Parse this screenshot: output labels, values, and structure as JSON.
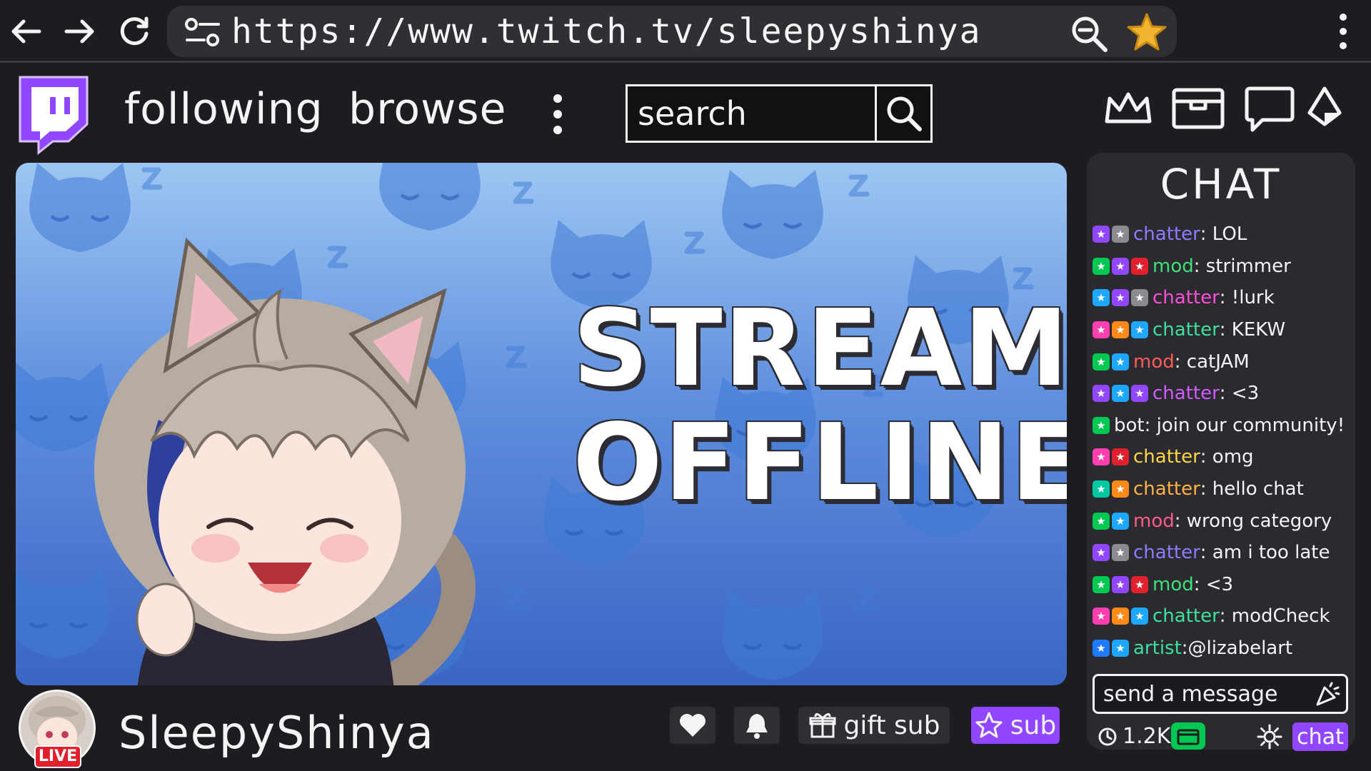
{
  "browser": {
    "url": "https://www.twitch.tv/sleepyshinya"
  },
  "header": {
    "following_label": "following",
    "browse_label": "browse",
    "search_placeholder": "search"
  },
  "banner": {
    "line1": "STREAM",
    "line2": "OFFLINE"
  },
  "channel": {
    "name": "SleepyShinya",
    "live_label": "LIVE",
    "gift_sub_label": "gift sub",
    "sub_label": "sub"
  },
  "chat": {
    "title": "CHAT",
    "messages": [
      {
        "badges": [
          "#9147ff",
          "#8a8a90"
        ],
        "role": "chatter",
        "name_color": "#8c7cff",
        "text": ": LOL"
      },
      {
        "badges": [
          "#00c853",
          "#9147ff",
          "#e0202c"
        ],
        "role": "mod",
        "name_color": "#3ee07a",
        "text": ": strimmer"
      },
      {
        "badges": [
          "#1ea7ff",
          "#9147ff",
          "#8a8a90"
        ],
        "role": "chatter",
        "name_color": "#ff4fd8",
        "text": ": !lurk"
      },
      {
        "badges": [
          "#ff3fb0",
          "#ff8a1a",
          "#1ea7ff"
        ],
        "role": "chatter",
        "name_color": "#3ee0a0",
        "text": ": KEKW"
      },
      {
        "badges": [
          "#00c853",
          "#1ea7ff"
        ],
        "role": "mod",
        "name_color": "#ff5b5b",
        "text": ": catJAM"
      },
      {
        "badges": [
          "#9147ff",
          "#1ea7ff",
          "#9147ff"
        ],
        "role": "chatter",
        "name_color": "#d05cff",
        "text": ": <3"
      },
      {
        "badges": [
          "#00c853"
        ],
        "role": "bot",
        "name_color": "#f4f4f4",
        "text": ": join our community!"
      },
      {
        "badges": [
          "#ff3fb0",
          "#e0202c"
        ],
        "role": "chatter",
        "name_color": "#ffd54a",
        "text": ": omg"
      },
      {
        "badges": [
          "#00c8a0",
          "#ff8a1a"
        ],
        "role": "chatter",
        "name_color": "#ffb347",
        "text": ": hello chat"
      },
      {
        "badges": [
          "#00c853",
          "#1ea7ff"
        ],
        "role": "mod",
        "name_color": "#ff5b8a",
        "text": ": wrong category"
      },
      {
        "badges": [
          "#9147ff",
          "#8a8a90"
        ],
        "role": "chatter",
        "name_color": "#8c7cff",
        "text": ": am i too late"
      },
      {
        "badges": [
          "#00c853",
          "#9147ff",
          "#e0202c"
        ],
        "role": "mod",
        "name_color": "#3ee07a",
        "text": ": <3"
      },
      {
        "badges": [
          "#ff3fb0",
          "#ff8a1a",
          "#1ea7ff"
        ],
        "role": "chatter",
        "name_color": "#3ee0a0",
        "text": ": modCheck"
      },
      {
        "badges": [
          "#1e7bff",
          "#1ea7ff"
        ],
        "role": "artist",
        "name_color": "#3ee0a0",
        "text": ":@lizabelart"
      }
    ],
    "input_placeholder": "send a message",
    "viewer_count": "1.2K",
    "send_label": "chat"
  },
  "colors": {
    "accent": "#9147ff",
    "background": "#1d1d21",
    "panel": "#2a2a2f",
    "banner_top": "#9dc6f2",
    "banner_bottom": "#3a66c4",
    "live_red": "#e0202c"
  },
  "icons": {
    "back": "arrow-left-icon",
    "forward": "arrow-right-icon",
    "reload": "reload-icon",
    "tune": "tune-icon",
    "zoom": "zoom-out-icon",
    "bookmark": "star-icon",
    "menu": "kebab-icon",
    "logo": "twitch-logo-icon",
    "search": "search-icon",
    "prime": "crown-icon",
    "inbox": "inbox-icon",
    "whispers": "chat-bubble-icon",
    "bits": "bits-gem-icon",
    "follow": "heart-icon",
    "notify": "bell-icon",
    "gift": "gift-icon",
    "subscribe": "star-outline-icon",
    "emote": "party-popper-icon",
    "viewers": "clock-icon",
    "points": "channel-points-icon",
    "settings": "gear-icon"
  }
}
